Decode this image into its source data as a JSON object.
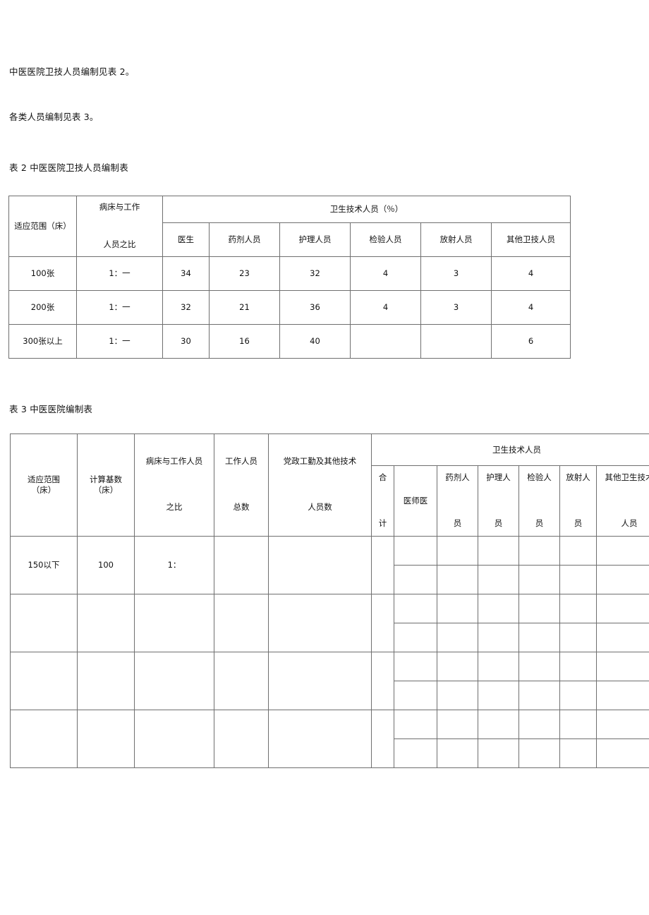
{
  "document": {
    "paragraphs": [
      "中医医院卫技人员编制见表 2。",
      "各类人员编制见表 3。"
    ],
    "table2": {
      "caption": "表 2 中医医院卫技人员编制表",
      "header": {
        "col_scope": "适应范围（床）",
        "col_ratio_line1": "病床与工作",
        "col_ratio_line2": "人员之比",
        "group_title": "卫生技术人员（％）",
        "sub_columns": [
          "医生",
          "药剂人员",
          "护理人员",
          "检验人员",
          "放射人员",
          "其他卫技人员"
        ]
      },
      "rows": [
        {
          "scope": "100张",
          "ratio": "1：一",
          "values": [
            "34",
            "23",
            "32",
            "4",
            "3",
            "4"
          ]
        },
        {
          "scope": "200张",
          "ratio": "1：一",
          "values": [
            "32",
            "21",
            "36",
            "4",
            "3",
            "4"
          ]
        },
        {
          "scope": "300张以上",
          "ratio": "1：一",
          "values": [
            "30",
            "16",
            "40",
            "",
            "",
            "6"
          ]
        }
      ]
    },
    "table3": {
      "caption": "表 3 中医医院编制表",
      "header": {
        "col_scope_line1": "适应范围",
        "col_scope_line2": "（床）",
        "col_base_line1": "计算基数",
        "col_base_line2": "（床）",
        "col_ratio_line1": "病床与工作人员",
        "col_ratio_line2": "之比",
        "col_staff_line1": "工作人员",
        "col_staff_line2": "总数",
        "col_admin_line1": "党政工勤及其他技术",
        "col_admin_line2": "人员数",
        "group_title": "卫生技术人员",
        "sub_columns": [
          {
            "line1": "合",
            "line2": "计"
          },
          {
            "line1": "医师医",
            "line2": ""
          },
          {
            "line1": "药剂人",
            "line2": "员"
          },
          {
            "line1": "护理人",
            "line2": "员"
          },
          {
            "line1": "检验人",
            "line2": "员"
          },
          {
            "line1": "放射人",
            "line2": "员"
          },
          {
            "line1": "其他卫生技术",
            "line2": "人员"
          }
        ]
      },
      "rows": [
        {
          "scope": "150以下",
          "base": "100",
          "ratio": "1：",
          "staff_total": "",
          "admin": "",
          "sub_values_top": [
            "",
            "",
            "",
            "",
            "",
            "",
            ""
          ],
          "sub_values_bottom": [
            "",
            "",
            "",
            "",
            "",
            "",
            ""
          ]
        },
        {
          "scope": "",
          "base": "",
          "ratio": "",
          "staff_total": "",
          "admin": "",
          "sub_values_top": [
            "",
            "",
            "",
            "",
            "",
            "",
            ""
          ],
          "sub_values_bottom": [
            "",
            "",
            "",
            "",
            "",
            "",
            ""
          ]
        },
        {
          "scope": "",
          "base": "",
          "ratio": "",
          "staff_total": "",
          "admin": "",
          "sub_values_top": [
            "",
            "",
            "",
            "",
            "",
            "",
            ""
          ],
          "sub_values_bottom": [
            "",
            "",
            "",
            "",
            "",
            "",
            ""
          ]
        },
        {
          "scope": "",
          "base": "",
          "ratio": "",
          "staff_total": "",
          "admin": "",
          "sub_values_top": [
            "",
            "",
            "",
            "",
            "",
            "",
            ""
          ],
          "sub_values_bottom": [
            "",
            "",
            "",
            "",
            "",
            "",
            ""
          ]
        }
      ]
    }
  },
  "colors": {
    "page_background": "#ffffff",
    "text": "#111111",
    "table_border": "#6f6f6f"
  }
}
